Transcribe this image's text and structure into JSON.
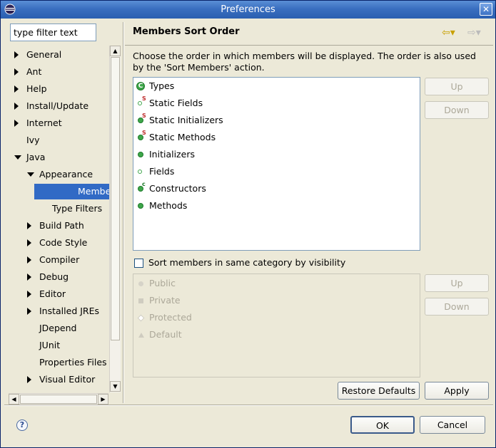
{
  "window": {
    "title": "Preferences",
    "close_label": "✕"
  },
  "filter": {
    "value": "type filter text"
  },
  "tree": [
    {
      "label": "General",
      "level": 0,
      "state": "closed"
    },
    {
      "label": "Ant",
      "level": 0,
      "state": "closed"
    },
    {
      "label": "Help",
      "level": 0,
      "state": "closed"
    },
    {
      "label": "Install/Update",
      "level": 0,
      "state": "closed"
    },
    {
      "label": "Internet",
      "level": 0,
      "state": "closed"
    },
    {
      "label": "Ivy",
      "level": 0,
      "state": "leaf"
    },
    {
      "label": "Java",
      "level": 0,
      "state": "open"
    },
    {
      "label": "Appearance",
      "level": 1,
      "state": "open"
    },
    {
      "label": "Members So",
      "level": 2,
      "state": "leaf",
      "selected": true
    },
    {
      "label": "Type Filters",
      "level": 2,
      "state": "leaf"
    },
    {
      "label": "Build Path",
      "level": 1,
      "state": "closed"
    },
    {
      "label": "Code Style",
      "level": 1,
      "state": "closed"
    },
    {
      "label": "Compiler",
      "level": 1,
      "state": "closed"
    },
    {
      "label": "Debug",
      "level": 1,
      "state": "closed"
    },
    {
      "label": "Editor",
      "level": 1,
      "state": "closed"
    },
    {
      "label": "Installed JREs",
      "level": 1,
      "state": "closed"
    },
    {
      "label": "JDepend",
      "level": 1,
      "state": "leaf"
    },
    {
      "label": "JUnit",
      "level": 1,
      "state": "leaf"
    },
    {
      "label": "Properties Files",
      "level": 1,
      "state": "leaf"
    },
    {
      "label": "Visual Editor",
      "level": 1,
      "state": "closed"
    }
  ],
  "page": {
    "title": "Members Sort Order",
    "description": "Choose the order in which members will be displayed. The order is also used by the 'Sort Members' action.",
    "nav_back": "⇦▾",
    "nav_forward": "⇨▾"
  },
  "members": [
    {
      "label": "Types",
      "icon": "class-icon"
    },
    {
      "label": "Static Fields",
      "icon": "static-field-icon"
    },
    {
      "label": "Static Initializers",
      "icon": "static-initializer-icon"
    },
    {
      "label": "Static Methods",
      "icon": "static-method-icon"
    },
    {
      "label": "Initializers",
      "icon": "initializer-icon"
    },
    {
      "label": "Fields",
      "icon": "field-icon"
    },
    {
      "label": "Constructors",
      "icon": "constructor-icon"
    },
    {
      "label": "Methods",
      "icon": "method-icon"
    }
  ],
  "buttons": {
    "up": "Up",
    "down": "Down",
    "up2": "Up",
    "down2": "Down",
    "restore_defaults": "Restore Defaults",
    "apply": "Apply",
    "ok": "OK",
    "cancel": "Cancel"
  },
  "sort_checkbox": {
    "label": "Sort members in same category by visibility",
    "checked": false
  },
  "visibility": [
    {
      "label": "Public",
      "icon": "public-icon"
    },
    {
      "label": "Private",
      "icon": "private-icon"
    },
    {
      "label": "Protected",
      "icon": "protected-icon"
    },
    {
      "label": "Default",
      "icon": "default-icon"
    }
  ],
  "help": {
    "icon_glyph": "?"
  },
  "colors": {
    "selection": "#316ac5",
    "member_icon": "#3ea64a",
    "static_overlay": "#c03030"
  }
}
